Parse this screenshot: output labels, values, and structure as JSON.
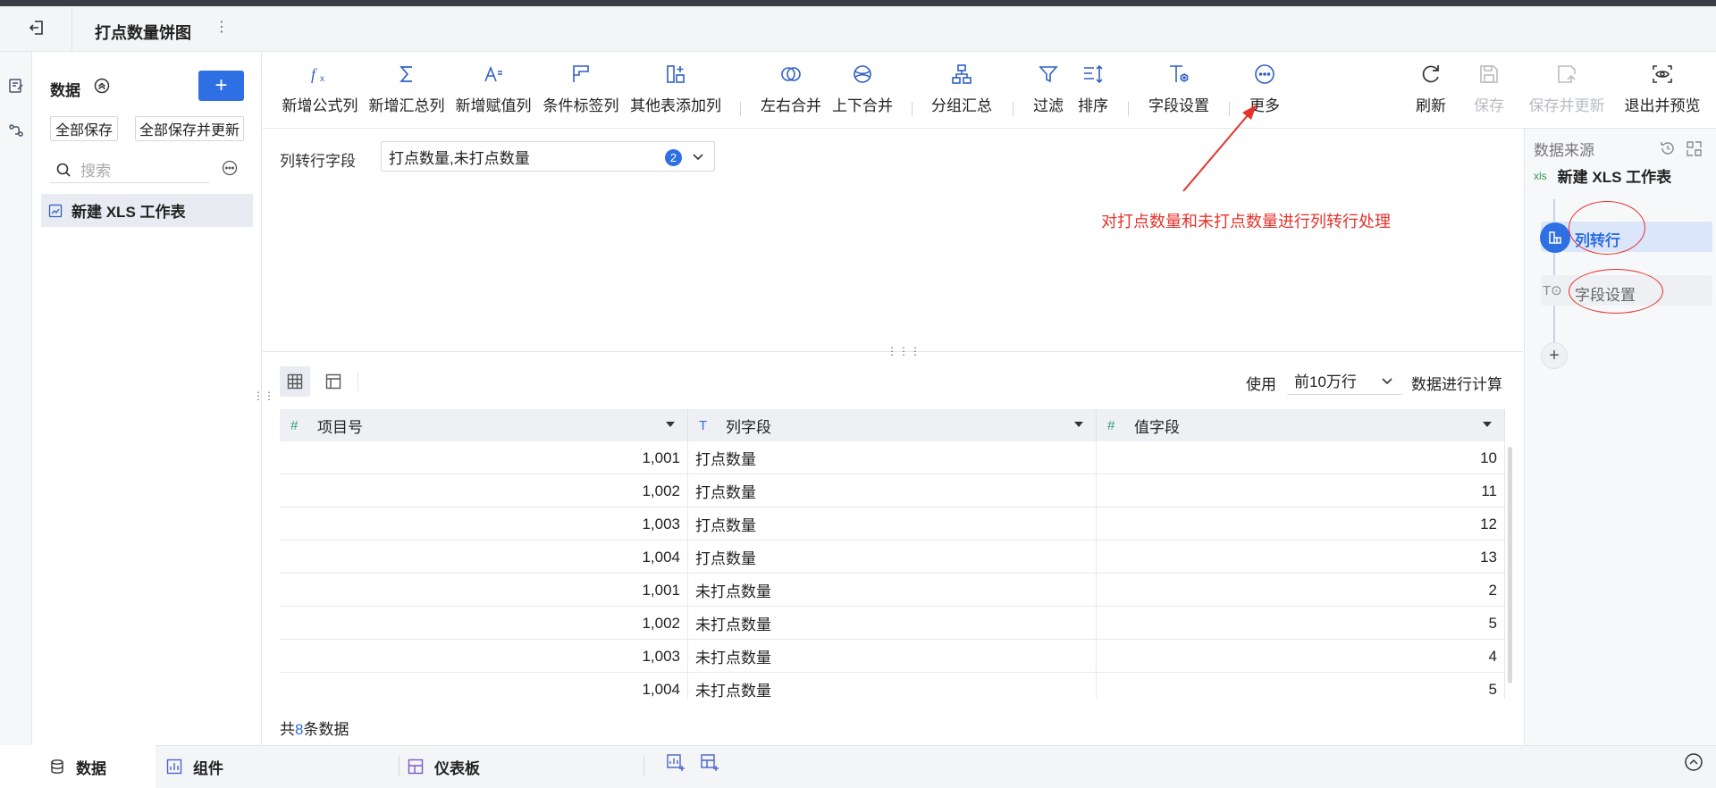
{
  "app": {
    "title": "打点数量饼图",
    "title_more": "⋮"
  },
  "data_panel": {
    "title": "数据",
    "add_label": "+",
    "save_all": "全部保存",
    "save_all_update": "全部保存并更新",
    "search_placeholder": "搜索",
    "tree_item": "新建 XLS 工作表"
  },
  "toolbar": {
    "items": [
      {
        "label": "新增公式列",
        "icon": "formula-icon"
      },
      {
        "label": "新增汇总列",
        "icon": "sum-icon"
      },
      {
        "label": "新增赋值列",
        "icon": "assign-icon"
      },
      {
        "label": "条件标签列",
        "icon": "flag-icon"
      },
      {
        "label": "其他表添加列",
        "icon": "add-column-icon"
      },
      {
        "label": "左右合并",
        "icon": "merge-horizontal-icon"
      },
      {
        "label": "上下合并",
        "icon": "merge-vertical-icon"
      },
      {
        "label": "分组汇总",
        "icon": "group-icon"
      },
      {
        "label": "过滤",
        "icon": "filter-icon"
      },
      {
        "label": "排序",
        "icon": "sort-icon"
      },
      {
        "label": "字段设置",
        "icon": "field-settings-icon"
      },
      {
        "label": "更多",
        "icon": "more-icon"
      },
      {
        "label": "刷新",
        "icon": "refresh-icon"
      },
      {
        "label": "保存",
        "icon": "save-icon"
      },
      {
        "label": "保存并更新",
        "icon": "save-update-icon"
      },
      {
        "label": "退出并预览",
        "icon": "preview-icon"
      }
    ]
  },
  "config": {
    "label": "列转行字段",
    "value": "打点数量,未打点数量",
    "count": "2"
  },
  "annotation": "对打点数量和未打点数量进行列转行处理",
  "preview": {
    "use_label": "使用",
    "rows_option": "前10万行",
    "calc_label": "数据进行计算",
    "columns": [
      {
        "name": "项目号",
        "type_icon": "#"
      },
      {
        "name": "列字段",
        "type_icon": "T"
      },
      {
        "name": "值字段",
        "type_icon": "#"
      }
    ],
    "rows": [
      [
        "1,001",
        "打点数量",
        "10"
      ],
      [
        "1,002",
        "打点数量",
        "11"
      ],
      [
        "1,003",
        "打点数量",
        "12"
      ],
      [
        "1,004",
        "打点数量",
        "13"
      ],
      [
        "1,001",
        "未打点数量",
        "2"
      ],
      [
        "1,002",
        "未打点数量",
        "5"
      ],
      [
        "1,003",
        "未打点数量",
        "4"
      ],
      [
        "1,004",
        "未打点数量",
        "5"
      ]
    ],
    "footer_prefix": "共",
    "footer_count": "8",
    "footer_suffix": "条数据"
  },
  "right_panel": {
    "title": "数据来源",
    "source_badge": "xls",
    "source_name": "新建 XLS 工作表",
    "steps": [
      "列转行",
      "字段设置"
    ],
    "step2_icon": "T⊙"
  },
  "bottom": {
    "tabs": [
      "数据",
      "组件",
      "仪表板"
    ]
  },
  "colors": {
    "accent": "#2f6fe4",
    "annotation": "#e4322b"
  }
}
